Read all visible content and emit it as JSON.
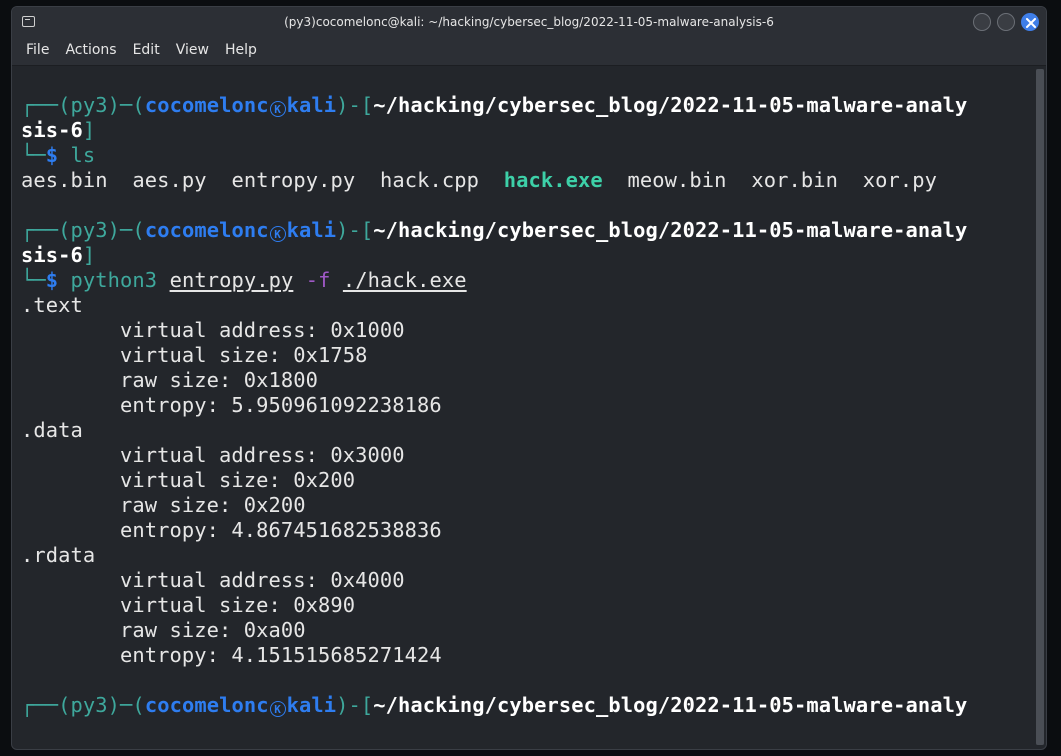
{
  "window": {
    "title": "(py3)cocomelonc@kali: ~/hacking/cybersec_blog/2022-11-05-malware-analysis-6"
  },
  "menu": [
    "File",
    "Actions",
    "Edit",
    "View",
    "Help"
  ],
  "prompt": {
    "frame_top": "┌──",
    "frame_bottom": "└─",
    "env": "(py3)",
    "dash": "─",
    "lparen": "(",
    "user": "cocomelonc",
    "kali_glyph": "K",
    "host": "kali",
    "rparen": ")",
    "sep": "-",
    "lbracket": "[",
    "path_part1": "~/hacking/cybersec_blog/2022-11-05-malware-analy",
    "path_part2": "sis-6",
    "rbracket": "]",
    "dollar": "$"
  },
  "commands": {
    "ls": "ls",
    "python_cmd": "python3",
    "python_script": "entropy.py",
    "python_flag": "-f",
    "python_arg": "./hack.exe"
  },
  "ls_output": [
    "aes.bin",
    "aes.py",
    "entropy.py",
    "hack.cpp",
    "hack.exe",
    "meow.bin",
    "xor.bin",
    "xor.py"
  ],
  "sections": [
    {
      "name": ".text",
      "virtual_address": "virtual address: 0x1000",
      "virtual_size": "virtual size: 0x1758",
      "raw_size": "raw size: 0x1800",
      "entropy": "entropy: 5.950961092238186"
    },
    {
      "name": ".data",
      "virtual_address": "virtual address: 0x3000",
      "virtual_size": "virtual size: 0x200",
      "raw_size": "raw size: 0x200",
      "entropy": "entropy: 4.867451682538836"
    },
    {
      "name": ".rdata",
      "virtual_address": "virtual address: 0x4000",
      "virtual_size": "virtual size: 0x890",
      "raw_size": "raw size: 0xa00",
      "entropy": "entropy: 4.151515685271424"
    }
  ]
}
